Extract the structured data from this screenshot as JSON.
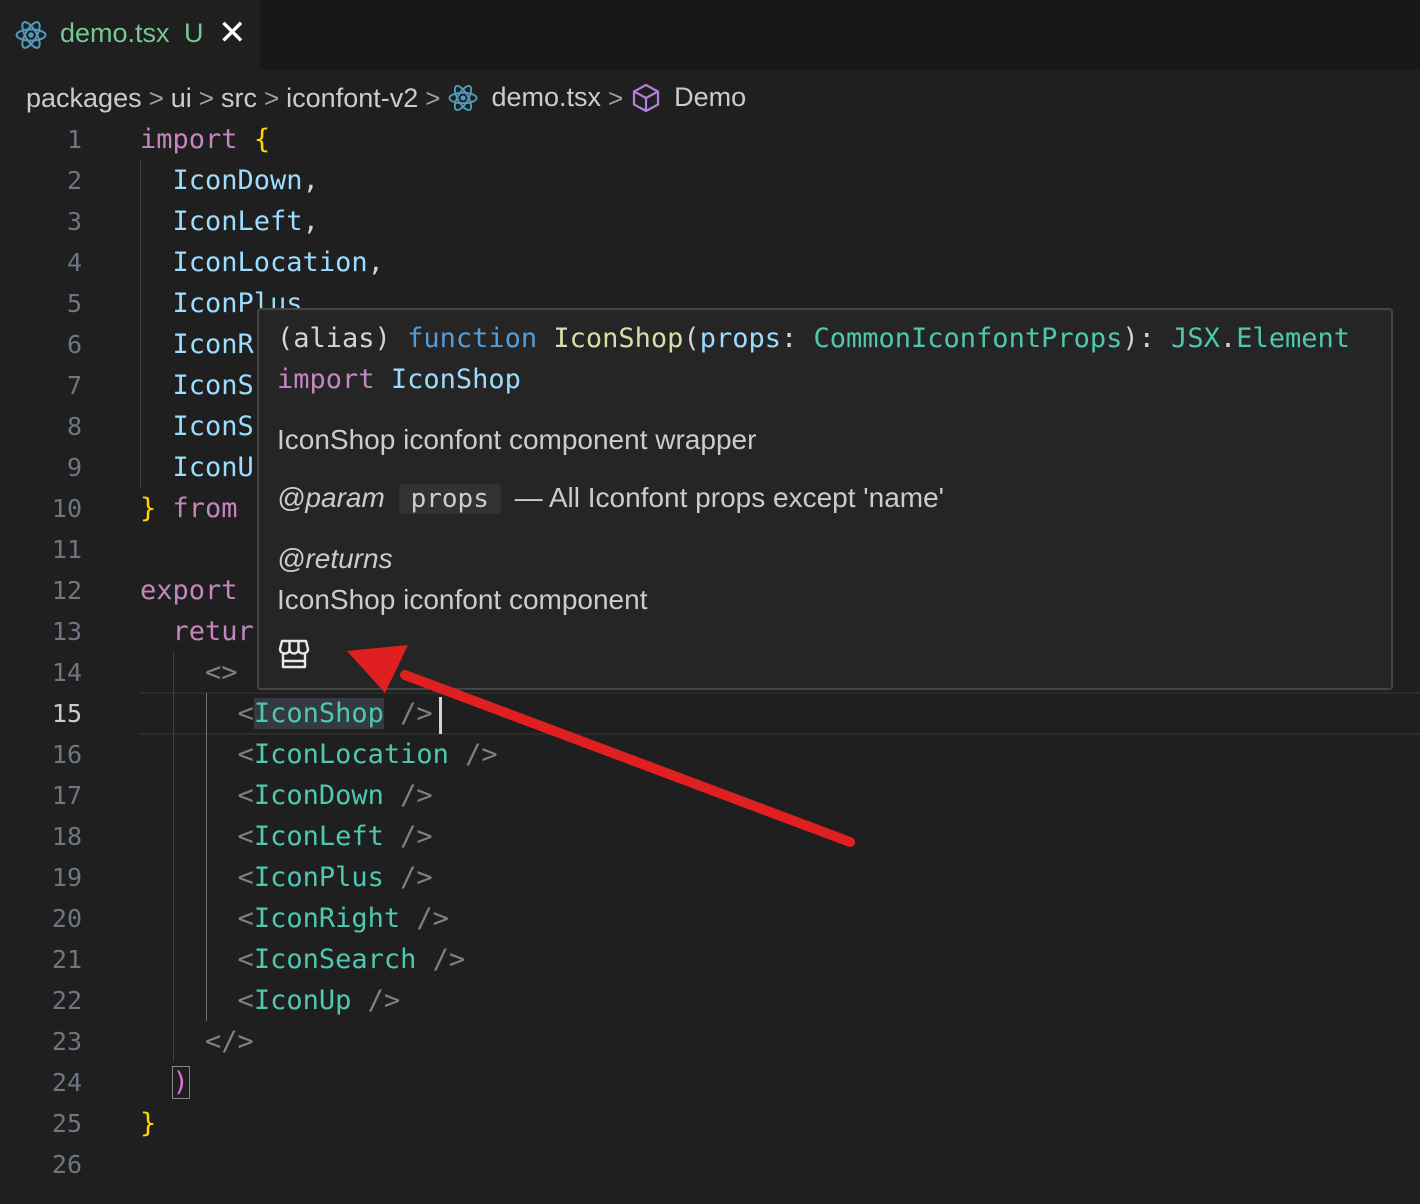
{
  "tab": {
    "filename": "demo.tsx",
    "status": "U",
    "close_glyph": "✕",
    "icon": "react-icon"
  },
  "breadcrumb": [
    {
      "label": "packages"
    },
    {
      "label": "ui"
    },
    {
      "label": "src"
    },
    {
      "label": "iconfont-v2"
    },
    {
      "label": "demo.tsx",
      "icon": "react-icon"
    },
    {
      "label": "Demo",
      "icon": "symbol-module-icon"
    }
  ],
  "breadcrumb_separator": ">",
  "editor": {
    "active_line": 15,
    "line_numbers": [
      "1",
      "2",
      "3",
      "4",
      "5",
      "6",
      "7",
      "8",
      "9",
      "10",
      "11",
      "12",
      "13",
      "14",
      "15",
      "16",
      "17",
      "18",
      "19",
      "20",
      "21",
      "22",
      "23",
      "24",
      "25",
      "26"
    ],
    "code": {
      "l1_kw": "import",
      "l1_br": "{",
      "l2": "IconDown",
      "l3": "IconLeft",
      "l4": "IconLocation",
      "l5": "IconPlus",
      "l6": "IconR",
      "l7": "IconS",
      "l8": "IconS",
      "l9": "IconU",
      "l10_br": "}",
      "l10_kw": "from",
      "l12_kw": "export",
      "l13_kw": "retur",
      "l14": "<>",
      "l15_tag": "IconShop",
      "l16_tag": "IconLocation",
      "l17_tag": "IconDown",
      "l18_tag": "IconLeft",
      "l19_tag": "IconPlus",
      "l20_tag": "IconRight",
      "l21_tag": "IconSearch",
      "l22_tag": "IconUp",
      "l23": "</>",
      "l24": ")",
      "l25": "}",
      "tag_open": "<",
      "tag_close": "/>",
      "comma": ","
    }
  },
  "hover": {
    "sig_alias": "(alias)",
    "sig_function": "function",
    "sig_name": "IconShop",
    "sig_paren_open": "(",
    "sig_param": "props",
    "sig_colon": ":",
    "sig_type": "CommonIconfontProps",
    "sig_paren_close": "):",
    "sig_return_ns": "JSX",
    "sig_dot": ".",
    "sig_return_type": "Element",
    "import_kw": "import",
    "import_name": "IconShop",
    "description": "IconShop iconfont component wrapper",
    "param_tag": "@param",
    "param_name": "props",
    "param_desc": "— All Iconfont props except 'name'",
    "returns_tag": "@returns",
    "returns_desc": "IconShop iconfont component",
    "preview_icon": "shop-icon"
  },
  "colors": {
    "keyword": "#c586c0",
    "variable": "#9cdcfe",
    "type": "#4ec9b0",
    "function": "#dcdcaa",
    "bracket": "#ffd700",
    "arrow": "#e02020"
  }
}
